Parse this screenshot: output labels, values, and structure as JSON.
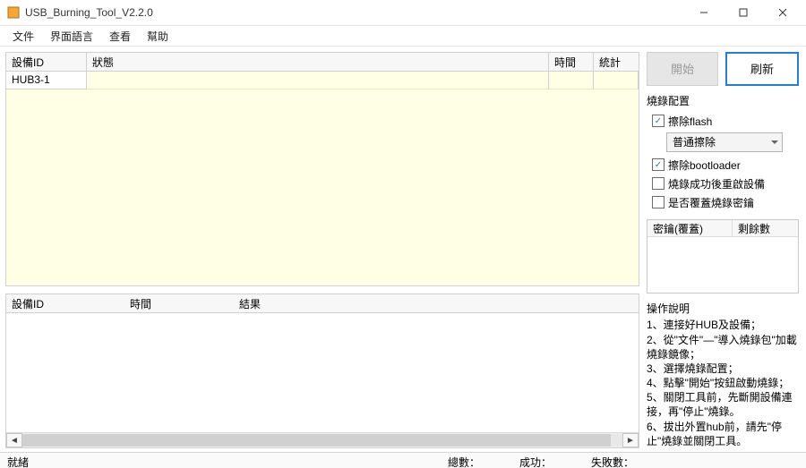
{
  "window": {
    "title": "USB_Burning_Tool_V2.2.0"
  },
  "menu": {
    "file": "文件",
    "language": "界面語言",
    "view": "查看",
    "help": "幫助"
  },
  "device_table": {
    "headers": {
      "id": "設備ID",
      "status": "狀態",
      "time": "時間",
      "stat": "統計"
    },
    "rows": [
      {
        "id": "HUB3-1",
        "status": "",
        "time": "",
        "stat": ""
      }
    ]
  },
  "result_table": {
    "headers": {
      "id": "設備ID",
      "time": "時間",
      "result": "結果"
    }
  },
  "right": {
    "start_label": "開始",
    "refresh_label": "刷新",
    "config_title": "燒錄配置",
    "erase_flash": {
      "label": "擦除flash",
      "checked": true
    },
    "erase_mode_selected": "普通擦除",
    "erase_bootloader": {
      "label": "擦除bootloader",
      "checked": true
    },
    "reboot_after": {
      "label": "燒錄成功後重啟設備",
      "checked": false
    },
    "overwrite_key": {
      "label": "是否覆蓋燒錄密鑰",
      "checked": false
    },
    "key_table": {
      "col1": "密鑰(覆蓋)",
      "col2": "剩餘數"
    },
    "instructions": {
      "title": "操作說明",
      "body": "1、連接好HUB及設備；\n2、從\"文件\"—\"導入燒錄包\"加載燒錄鏡像；\n3、選擇燒錄配置；\n4、點擊\"開始\"按鈕啟動燒錄；\n5、關閉工具前，先斷開設備連接，再\"停止\"燒錄。\n6、拔出外置hub前，請先\"停止\"燒錄並關閉工具。"
    }
  },
  "status": {
    "ready": "就緒",
    "total": "總數：",
    "ok": "成功：",
    "fail": "失敗數："
  }
}
